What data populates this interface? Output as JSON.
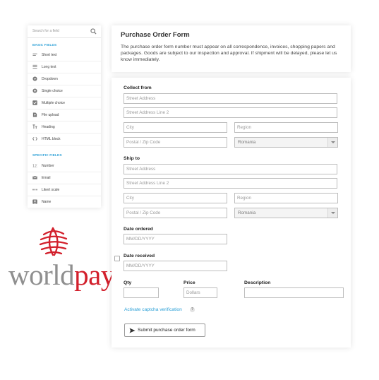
{
  "sidebar": {
    "search_placeholder": "Search for a field",
    "basic_fields_title": "BASIC FIELDS",
    "specific_fields_title": "SPECIFIC FIELDS",
    "basic_items": [
      {
        "label": "Short text",
        "icon": "short-text-icon"
      },
      {
        "label": "Long text",
        "icon": "long-text-icon"
      },
      {
        "label": "Dropdown",
        "icon": "dropdown-icon"
      },
      {
        "label": "Single choice",
        "icon": "radio-icon"
      },
      {
        "label": "Multiple choice",
        "icon": "checkbox-icon"
      },
      {
        "label": "File upload",
        "icon": "upload-icon"
      },
      {
        "label": "Heading",
        "icon": "heading-icon"
      },
      {
        "label": "HTML block",
        "icon": "code-icon"
      }
    ],
    "specific_items": [
      {
        "label": "Number",
        "icon": "number-icon"
      },
      {
        "label": "Email",
        "icon": "email-icon"
      },
      {
        "label": "Likert scale",
        "icon": "likert-icon"
      },
      {
        "label": "Name",
        "icon": "name-icon"
      }
    ]
  },
  "logo": {
    "part1": "world",
    "part2": "pay",
    "color1": "#8f8f8f",
    "color2": "#d21f2b"
  },
  "header": {
    "title": "Purchase Order Form",
    "description": "The purchase order form number must appear on all correspondence, invoices, shopping papers and packages. Goods are subject to our inspection and approval. If shipment will be delayed, please let us know immediately."
  },
  "form": {
    "collect_from": {
      "title": "Collect from",
      "street": "Street Address",
      "street2": "Street Address Line 2",
      "city": "City",
      "region": "Region",
      "postal": "Postal / Zip Code",
      "country": "Romania"
    },
    "ship_to": {
      "title": "Ship to",
      "street": "Street Address",
      "street2": "Street Address Line 2",
      "city": "City",
      "region": "Region",
      "postal": "Postal / Zip Code",
      "country": "Romania"
    },
    "date_ordered": {
      "label": "Date ordered",
      "placeholder": "MM/DD/YYYY"
    },
    "date_received": {
      "label": "Date received",
      "placeholder": "MM/DD/YYYY"
    },
    "items": {
      "qty_label": "Qty",
      "price_label": "Price",
      "price_placeholder": "Dollars",
      "description_label": "Description"
    },
    "captcha_link": "Activate captcha verification",
    "help_glyph": "?",
    "submit_label": "Submit purchase order form"
  },
  "colors": {
    "accent": "#2a9fd6",
    "brand_red": "#d21f2b"
  }
}
